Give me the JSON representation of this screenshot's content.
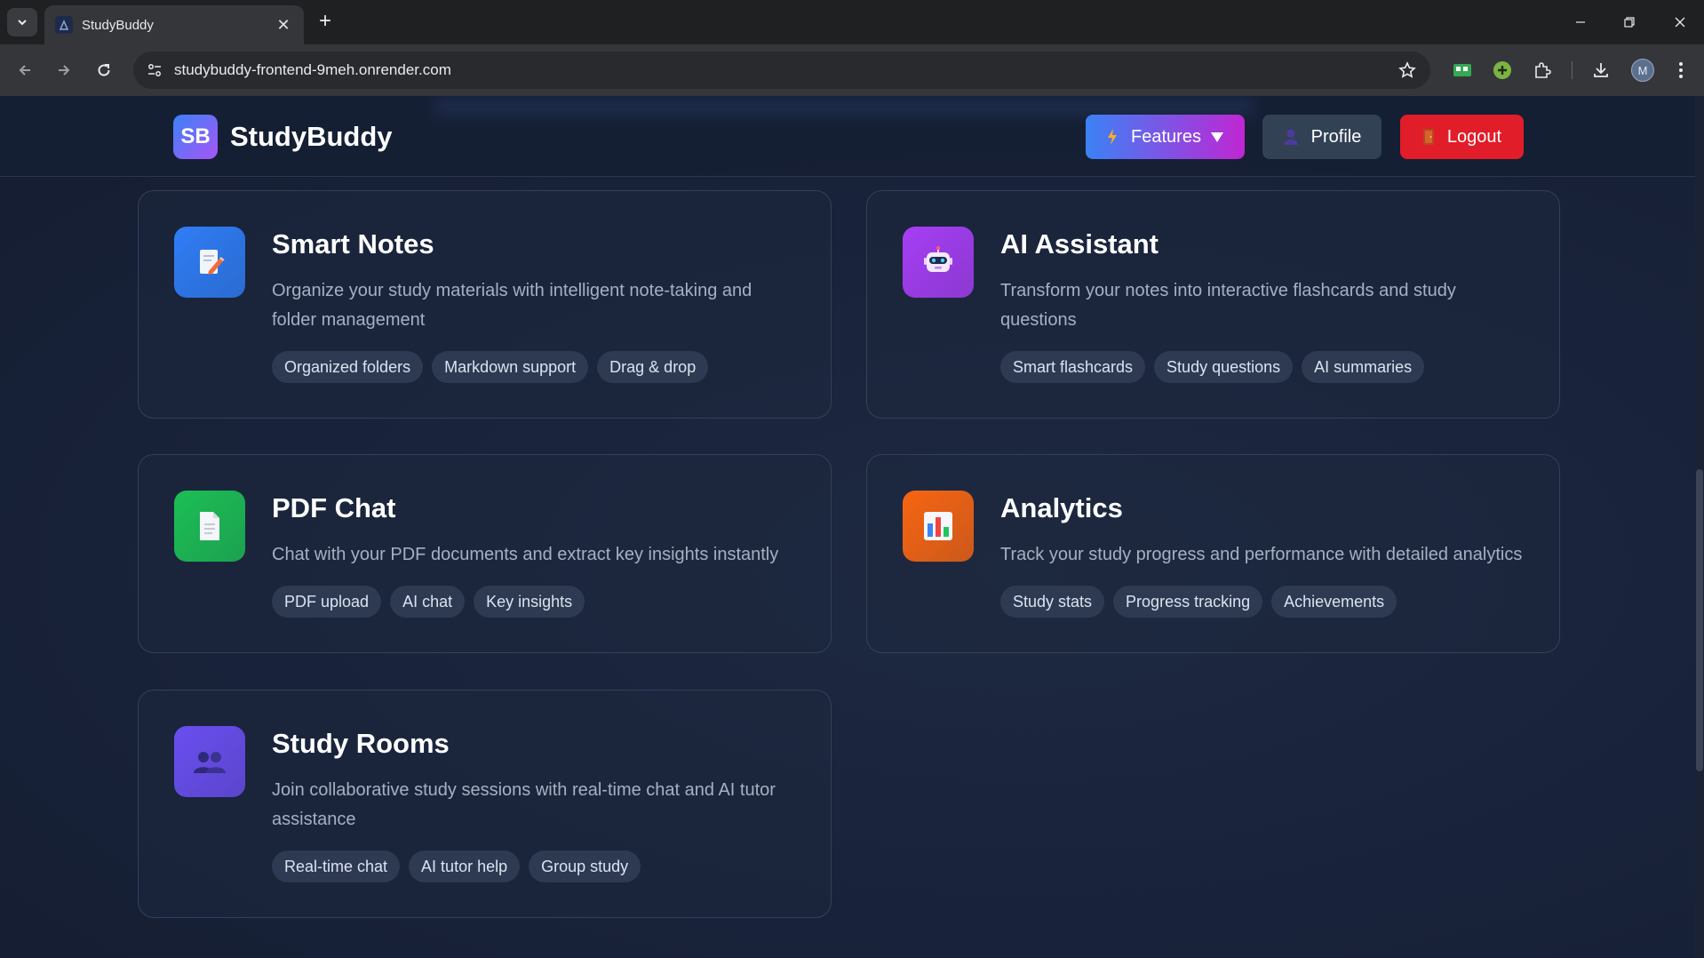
{
  "browser": {
    "tab_title": "StudyBuddy",
    "url": "studybuddy-frontend-9meh.onrender.com",
    "avatar_letter": "M"
  },
  "header": {
    "logo_badge": "SB",
    "logo_text": "StudyBuddy",
    "features_label": "Features",
    "profile_label": "Profile",
    "logout_label": "Logout"
  },
  "features": [
    {
      "title": "Smart Notes",
      "description": "Organize your study materials with intelligent note-taking and folder management",
      "icon": "notes-pencil-icon",
      "color": "#2f7df6",
      "tags": [
        "Organized folders",
        "Markdown support",
        "Drag & drop"
      ]
    },
    {
      "title": "AI Assistant",
      "description": "Transform your notes into interactive flashcards and study questions",
      "icon": "robot-icon",
      "color": "#a73ef5",
      "tags": [
        "Smart flashcards",
        "Study questions",
        "AI summaries"
      ]
    },
    {
      "title": "PDF Chat",
      "description": "Chat with your PDF documents and extract key insights instantly",
      "icon": "document-icon",
      "color": "#1cbf55",
      "tags": [
        "PDF upload",
        "AI chat",
        "Key insights"
      ]
    },
    {
      "title": "Analytics",
      "description": "Track your study progress and performance with detailed analytics",
      "icon": "bar-chart-icon",
      "color": "#f76512",
      "tags": [
        "Study stats",
        "Progress tracking",
        "Achievements"
      ]
    },
    {
      "title": "Study Rooms",
      "description": "Join collaborative study sessions with real-time chat and AI tutor assistance",
      "icon": "people-icon",
      "color": "#6a4ef0",
      "tags": [
        "Real-time chat",
        "AI tutor help",
        "Group study"
      ]
    }
  ]
}
